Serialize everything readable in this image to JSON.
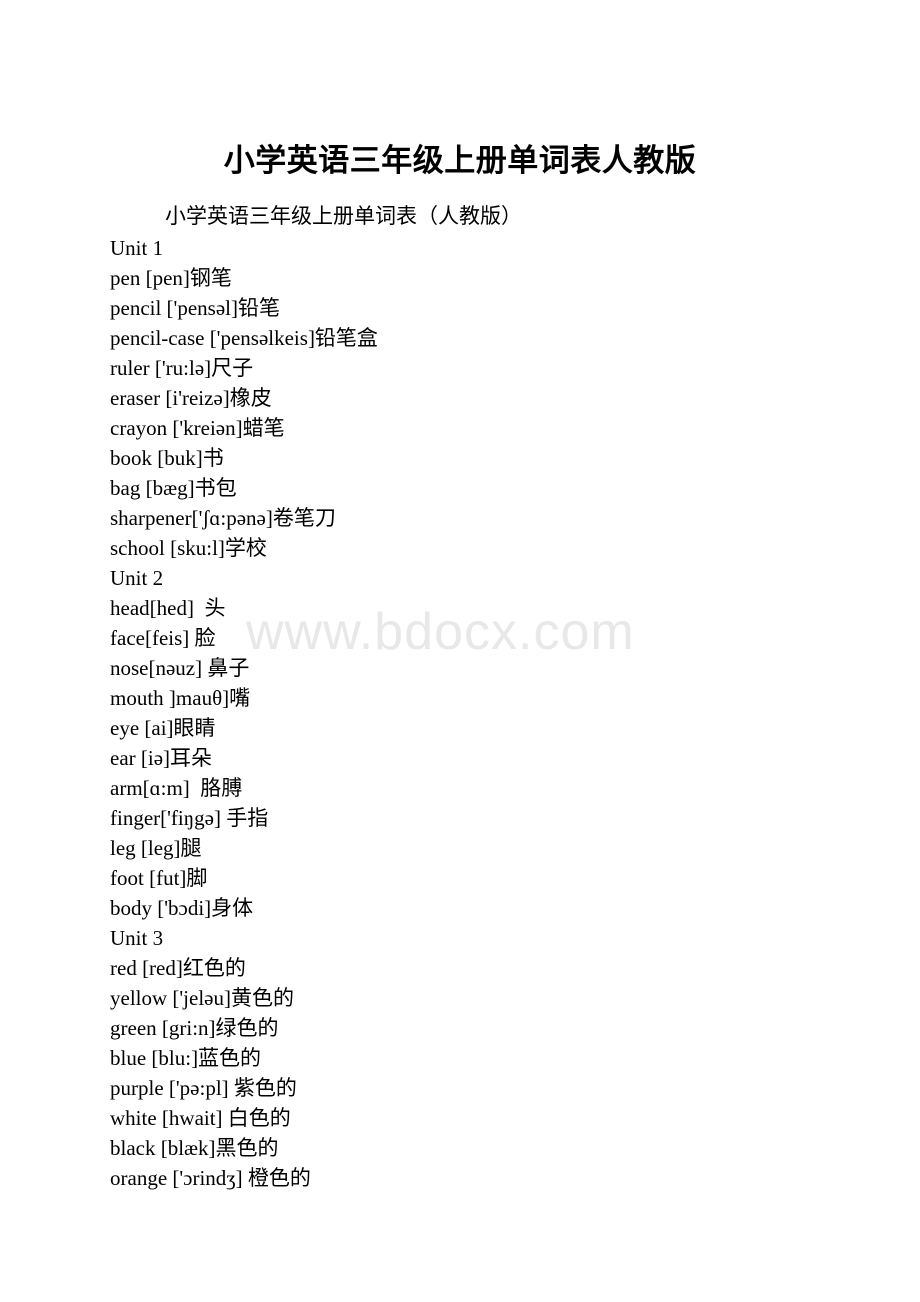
{
  "document": {
    "title": "小学英语三年级上册单词表人教版",
    "subtitle": "小学英语三年级上册单词表（人教版）",
    "watermark": "www.bdocx.com",
    "watermark_color": "#e8e8e8",
    "text_color": "#000000",
    "background_color": "#ffffff"
  },
  "lines": [
    "Unit 1",
    "pen [pen]钢笔",
    "pencil ['pensəl]铅笔",
    "pencil-case ['pensəlkeis]铅笔盒",
    "ruler ['ru:lə]尺子",
    "eraser [i'reizə]橡皮",
    "crayon ['kreiən]蜡笔",
    "book [buk]书",
    "bag [bæg]书包",
    "sharpener['ʃɑ:pənə]卷笔刀",
    "school [sku:l]学校",
    "Unit 2",
    "head[hed]  头",
    "face[feis] 脸",
    "nose[nəuz] 鼻子",
    "mouth ]mauθ]嘴",
    "eye [ai]眼睛",
    "ear [iə]耳朵",
    "arm[ɑ:m]  胳膊",
    "finger['fiŋgə] 手指",
    "leg [leg]腿",
    "foot [fut]脚",
    "body ['bɔdi]身体",
    "Unit 3",
    "red [red]红色的",
    "yellow ['jeləu]黄色的",
    "green [gri:n]绿色的",
    "blue [blu:]蓝色的",
    "purple ['pə:pl] 紫色的",
    "white [hwait] 白色的",
    "black [blæk]黑色的",
    "orange ['ɔrindʒ] 橙色的"
  ]
}
